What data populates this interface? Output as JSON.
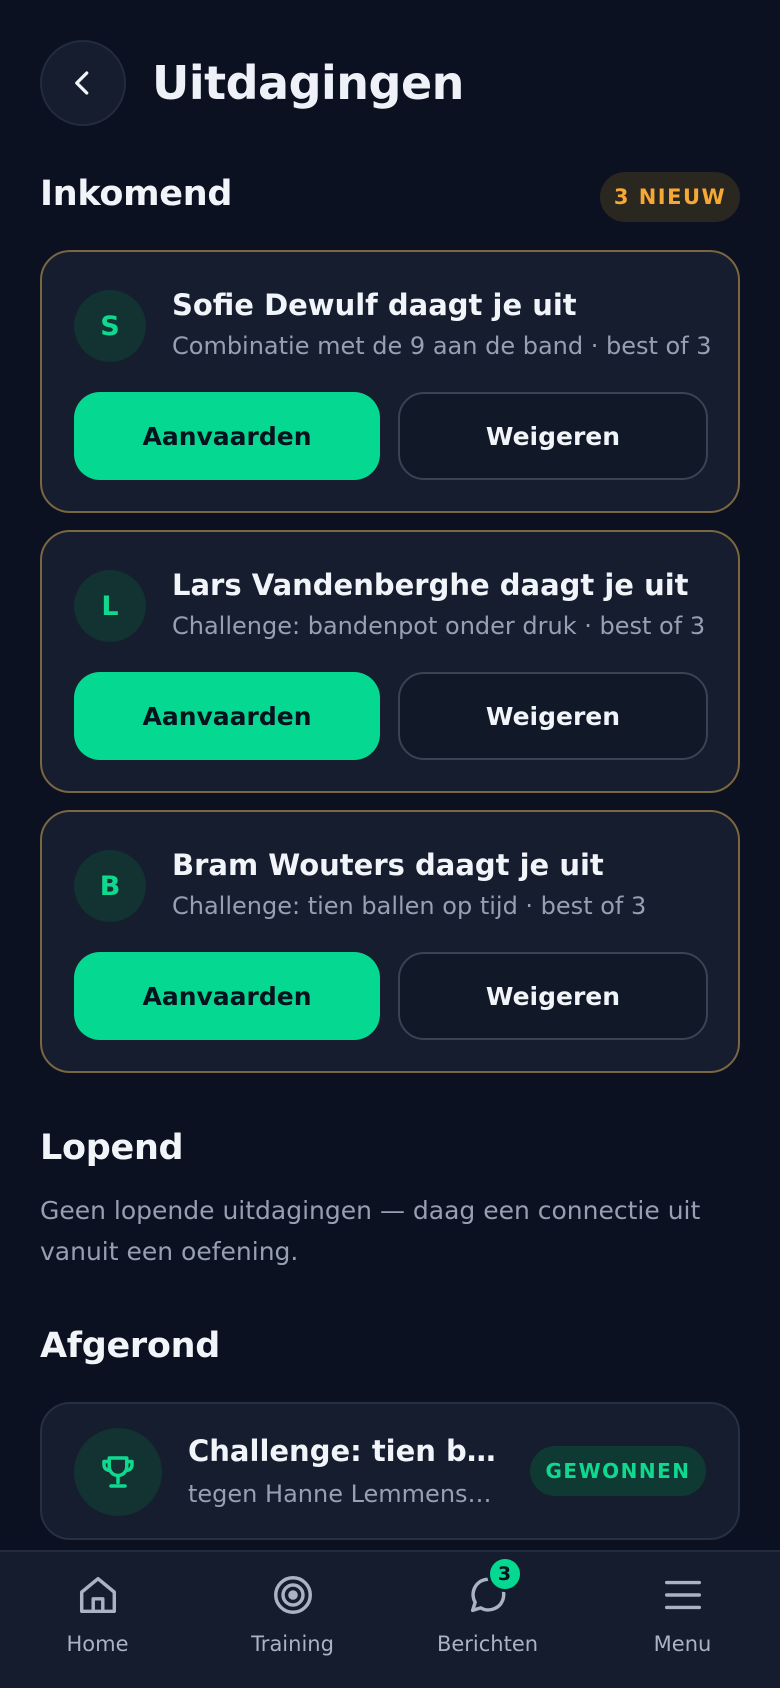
{
  "header": {
    "title": "Uitdagingen"
  },
  "incoming": {
    "title": "Inkomend",
    "badge": "3 NIEUW",
    "cards": [
      {
        "initial": "S",
        "title": "Sofie Dewulf daagt je uit",
        "subtitle": "Combinatie met de 9 aan de band · best of 3",
        "accept": "Aanvaarden",
        "decline": "Weigeren"
      },
      {
        "initial": "L",
        "title": "Lars Vandenberghe daagt je uit",
        "subtitle": "Challenge: bandenpot onder druk · best of 3",
        "accept": "Aanvaarden",
        "decline": "Weigeren"
      },
      {
        "initial": "B",
        "title": "Bram Wouters daagt je uit",
        "subtitle": "Challenge: tien ballen op tijd · best of 3",
        "accept": "Aanvaarden",
        "decline": "Weigeren"
      }
    ]
  },
  "ongoing": {
    "title": "Lopend",
    "empty_text": "Geen lopende uitdagingen — daag een connectie uit vanuit een oefening."
  },
  "finished": {
    "title": "Afgerond",
    "items": [
      {
        "title": "Challenge: tien balle...",
        "subtitle": "tegen Hanne Lemmens · ...",
        "result": "GEWONNEN",
        "icon": "trophy-icon"
      }
    ]
  },
  "nav": {
    "items": [
      {
        "label": "Home",
        "icon": "home-icon"
      },
      {
        "label": "Training",
        "icon": "target-icon"
      },
      {
        "label": "Berichten",
        "icon": "chat-icon",
        "badge": "3"
      },
      {
        "label": "Menu",
        "icon": "menu-icon"
      }
    ]
  },
  "colors": {
    "background": "#0b1120",
    "card": "#151d2e",
    "accent": "#05d991",
    "warning": "#f5a833",
    "card_border_incoming": "#7a6640"
  }
}
